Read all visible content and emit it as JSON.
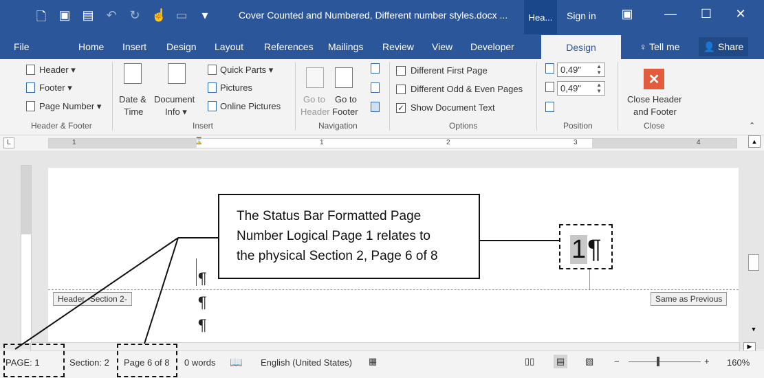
{
  "titlebar": {
    "quick_icons": [
      "new-doc-icon",
      "save-icon",
      "save-as-icon",
      "undo-icon",
      "redo-icon",
      "touch-mode-icon",
      "format-icon",
      "customize-icon"
    ],
    "document_title": "Cover Counted and Numbered, Different number styles.docx ...",
    "context_tab": "Hea...",
    "sign_in": "Sign in"
  },
  "tabs": [
    "File",
    "Home",
    "Insert",
    "Design",
    "Layout",
    "References",
    "Mailings",
    "Review",
    "View",
    "Developer"
  ],
  "active_tab": "Design",
  "tell_me": "Tell me",
  "share": "Share",
  "ribbon": {
    "header_footer": {
      "header": "Header",
      "footer": "Footer",
      "page_number": "Page Number",
      "label": "Header & Footer"
    },
    "insert": {
      "date_time_1": "Date &",
      "date_time_2": "Time",
      "doc_info_1": "Document",
      "doc_info_2": "Info",
      "quick_parts": "Quick Parts",
      "pictures": "Pictures",
      "online_pictures": "Online Pictures",
      "label": "Insert"
    },
    "navigation": {
      "goto_header_1": "Go to",
      "goto_header_2": "Header",
      "goto_footer_1": "Go to",
      "goto_footer_2": "Footer",
      "label": "Navigation"
    },
    "options": {
      "different_first_page": "Different First Page",
      "different_odd_even": "Different Odd & Even Pages",
      "show_document_text": "Show Document Text",
      "checked": [
        false,
        false,
        true
      ],
      "label": "Options"
    },
    "position": {
      "header_from_top": "0,49\"",
      "footer_from_bottom": "0,49\"",
      "label": "Position"
    },
    "close": {
      "close_1": "Close Header",
      "close_2": "and Footer",
      "label": "Close"
    }
  },
  "ruler": {
    "corner": "L",
    "numbers": [
      "1",
      "1",
      "2",
      "3",
      "4"
    ]
  },
  "document": {
    "header_tag": "Header -Section 2-",
    "same_as_previous": "Same as Previous",
    "page_number_digit": "1",
    "pilcrow": "¶",
    "callout_lines": [
      "The Status Bar Formatted Page",
      "Number Logical Page 1 relates to",
      "the physical Section 2, Page 6 of 8"
    ]
  },
  "statusbar": {
    "page": "PAGE: 1",
    "section": "Section: 2",
    "page_of": "Page 6 of 8",
    "words": "0 words",
    "language": "English (United States)",
    "zoom": "160%",
    "zoom_minus": "−",
    "zoom_plus": "+"
  },
  "colors": {
    "title_blue": "#2b579a",
    "ribbon_bg": "#f3f3f3",
    "close_red": "#e25b3c"
  }
}
